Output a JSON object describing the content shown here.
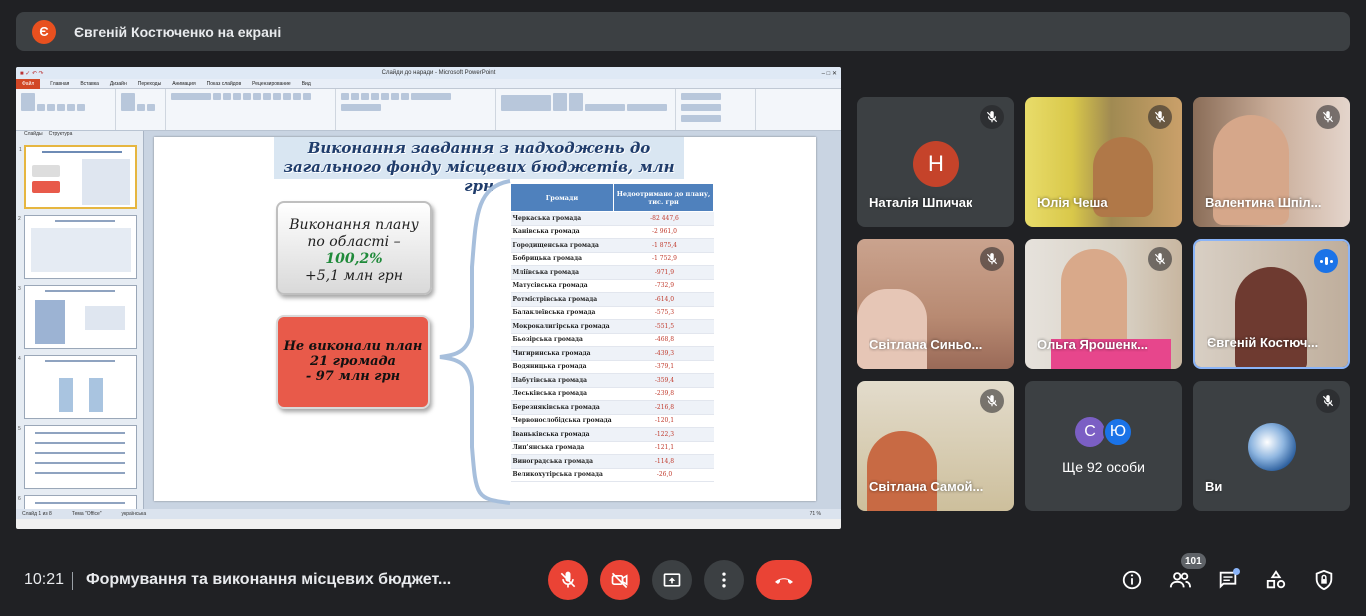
{
  "presenter": {
    "initial": "Є",
    "text": "Євгеній Костюченко на екрані"
  },
  "slide": {
    "title_line1": "Виконання завдання з надходжень до",
    "title_line2": "загального фонду місцевих бюджетів, млн грн",
    "plan_line1": "Виконання плану",
    "plan_line2": "по області –",
    "plan_pct": "100,2%",
    "plan_extra": "+5,1 млн грн",
    "fail_line1": "Не виконали план",
    "fail_line2": "21 громада",
    "fail_line3": "- 97 млн грн",
    "table_header_col1": "Громади",
    "table_header_col2": "Недоотримано до плану, тис. грн",
    "rows": [
      {
        "name": "Черкаська громада",
        "value": "-82 447,6"
      },
      {
        "name": "Канівська громада",
        "value": "-2 961,0"
      },
      {
        "name": "Городищенська громада",
        "value": "-1 875,4"
      },
      {
        "name": "Бобрицька громада",
        "value": "-1 752,9"
      },
      {
        "name": "Мліївська громада",
        "value": "-971,9"
      },
      {
        "name": "Матусівська громада",
        "value": "-732,9"
      },
      {
        "name": "Ротмістрівська громада",
        "value": "-614,0"
      },
      {
        "name": "Балаклеївська громада",
        "value": "-575,3"
      },
      {
        "name": "Мокрокалигірська громада",
        "value": "-551,5"
      },
      {
        "name": "Бьозірська громада",
        "value": "-468,8"
      },
      {
        "name": "Чигиринська громада",
        "value": "-439,3"
      },
      {
        "name": "Водяницька громада",
        "value": "-379,1"
      },
      {
        "name": "Набутівська громада",
        "value": "-359,4"
      },
      {
        "name": "Леськівська громада",
        "value": "-239,8"
      },
      {
        "name": "Березняківська громада",
        "value": "-216,8"
      },
      {
        "name": "Червонослобідська громада",
        "value": "-120,1"
      },
      {
        "name": "Іваньківська громада",
        "value": "-122,3"
      },
      {
        "name": "Лип'янська громада",
        "value": "-121,1"
      },
      {
        "name": "Виноградська громада",
        "value": "-114,8"
      },
      {
        "name": "Великохутірська громада",
        "value": "-26,0"
      }
    ]
  },
  "ppt": {
    "window_title": "Слайди до наради - Microsoft PowerPoint",
    "file_tab": "Файл",
    "tabs": [
      "Главная",
      "Вставка",
      "Дизайн",
      "Переходы",
      "Анимация",
      "Показ слайдов",
      "Рецензирование",
      "Вид"
    ],
    "panel_tabs": [
      "Слайды",
      "Структура"
    ],
    "status_items": [
      "Слайд 1 из 8",
      "Тема \"Office\"",
      "українська"
    ],
    "zoom": "71 %"
  },
  "participants": [
    {
      "name": "Наталія Шпичак",
      "initial": "Н",
      "color": "#c5432a"
    },
    {
      "name": "Юлія Чеша"
    },
    {
      "name": "Валентина Шпіл..."
    },
    {
      "name": "Світлана Синьо..."
    },
    {
      "name": "Ольга Ярошенк..."
    },
    {
      "name": "Євгеній Костюч..."
    },
    {
      "name": "Світлана Самой..."
    },
    {
      "name": "Ще 92 особи",
      "initials": [
        "С",
        "Ю"
      ]
    },
    {
      "name": "Ви"
    }
  ],
  "bottom": {
    "time": "10:21",
    "meeting": "Формування та виконання місцевих бюджет...",
    "people_count": "101"
  },
  "colors": {
    "background": "#202124",
    "tile": "#3c4043",
    "danger": "#ea4335",
    "accent": "#1a73e8"
  }
}
